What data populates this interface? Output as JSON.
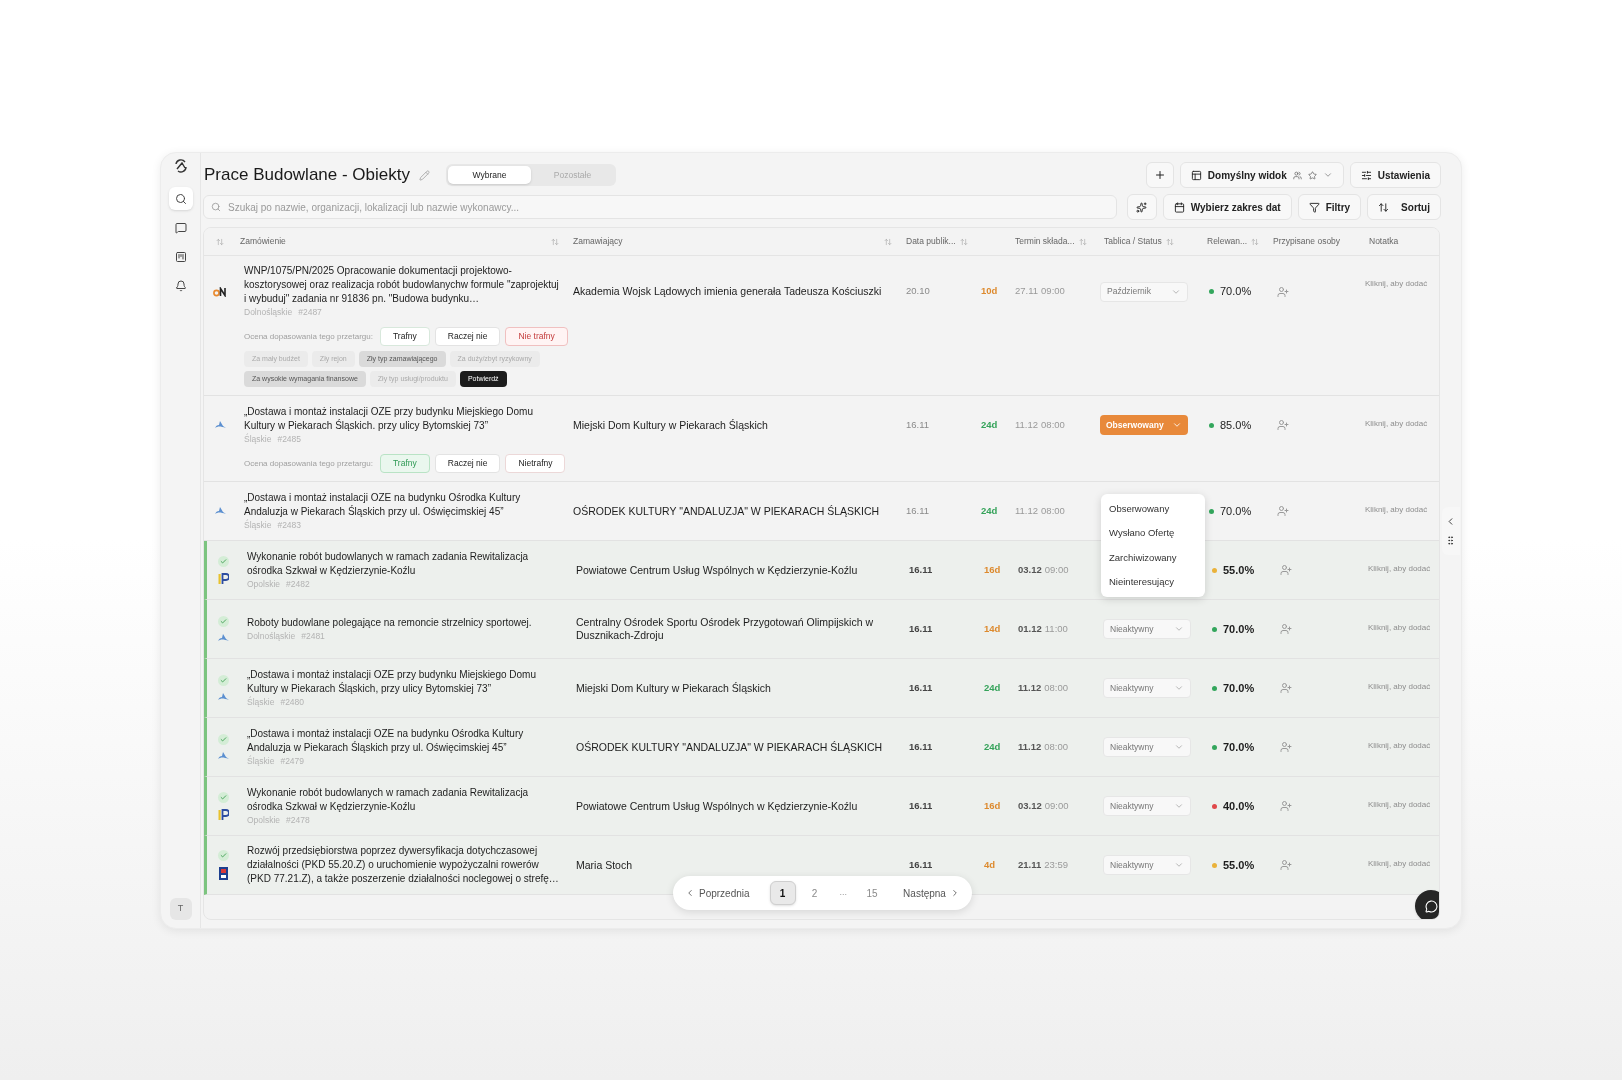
{
  "sidebar": {
    "items": [
      {
        "kind": "search",
        "selected": true
      },
      {
        "kind": "chat",
        "selected": false
      },
      {
        "kind": "board",
        "selected": false
      },
      {
        "kind": "alerts",
        "selected": false
      }
    ],
    "avatar": "T"
  },
  "title": "Prace Budowlane - Obiekty",
  "view_tabs": [
    {
      "label": "Wybrane",
      "selected": true
    },
    {
      "label": "Pozostałe",
      "selected": false
    }
  ],
  "toolbar": {
    "view_button": "Domyślny widok",
    "settings_button": "Ustawienia",
    "date_button": "Wybierz zakres dat",
    "filter_button": "Filtry",
    "sort_button": "Sortuj"
  },
  "search": {
    "placeholder": "Szukaj po nazwie, organizacji, lokalizacji lub nazwie wykonawcy..."
  },
  "table": {
    "columns": [
      {
        "sortable": true
      },
      {
        "label": "Zamówienie",
        "sortable": true
      },
      {
        "label": "Zamawiający",
        "sortable": true
      },
      {
        "label": "Data publik...",
        "sortable": true
      },
      {
        "sortable": false
      },
      {
        "label": "Termin składa...",
        "sortable": true
      },
      {
        "label": "Tablica / Status",
        "sortable": true
      },
      {
        "label": "Relewan...",
        "sortable": true
      },
      {
        "label": "Przypisane osoby",
        "sortable": false
      },
      {
        "label": "Notatka",
        "sortable": false
      }
    ],
    "rows": [
      {
        "logo": {
          "kind": "on"
        },
        "verified": false,
        "title": "WNP/1075/PN/2025 Opracowanie dokumentacji projektowo-kosztorysowej oraz realizacja robót budowlanychw formule \"zaprojektuj i wybuduj\" zadania nr 91836 pn. \"Budowa budynku…",
        "region": "Dolnośląskie",
        "number": "#2487",
        "client": "Akademia Wojsk Lądowych imienia generała Tadeusza Kościuszki",
        "published": "20.10",
        "days": {
          "text": "10d",
          "color": "#dd8a2e"
        },
        "deadline_date": "27.11",
        "deadline_time": "09:00",
        "status": {
          "label": "Październik"
        },
        "relevance": {
          "text": "70.0%",
          "color": "#33a65c"
        },
        "note": "Kliknij, aby dodać",
        "rating": {
          "label": "Ocena dopasowania tego przetargu:",
          "options": [
            {
              "label": "Trafny",
              "kind": "good",
              "selected": false
            },
            {
              "label": "Raczej nie",
              "kind": "neutral",
              "selected": false
            },
            {
              "label": "Nie trafny",
              "kind": "bad",
              "selected": true
            }
          ],
          "reasons": [
            {
              "label": "Za mały budżet",
              "selected": false
            },
            {
              "label": "Zły rejon",
              "selected": false
            },
            {
              "label": "Zły typ zamawiającego",
              "selected": true
            },
            {
              "label": "Za duży/zbyt ryzykowny",
              "selected": false
            },
            {
              "label": "Za wysokie wymagania finansowe",
              "selected": true
            },
            {
              "label": "Zły typ usługi/produktu",
              "selected": false
            }
          ],
          "confirm": "Potwierdź"
        }
      },
      {
        "logo": {
          "kind": "bird"
        },
        "verified": false,
        "title": "„Dostawa i montaż instalacji OZE przy budynku Miejskiego Domu Kultury w Piekarach Śląskich. przy ulicy Bytomskiej 73”",
        "region": "Śląskie",
        "number": "#2485",
        "client": "Miejski Dom Kultury w Piekarach Śląskich",
        "published": "16.11",
        "days": {
          "text": "24d",
          "color": "#35a35a"
        },
        "deadline_date": "11.12",
        "deadline_time": "08:00",
        "status": {
          "label": "Obserwowany",
          "color": "#e8893a"
        },
        "relevance": {
          "text": "85.0%",
          "color": "#33a65c"
        },
        "note": "Kliknij, aby dodać",
        "rating": {
          "label": "Ocena dopasowania tego przetargu:",
          "options": [
            {
              "label": "Trafny",
              "kind": "good",
              "selected": true
            },
            {
              "label": "Raczej nie",
              "kind": "neutral",
              "selected": false
            },
            {
              "label": "Nietrafny",
              "kind": "bad",
              "selected": false
            }
          ]
        }
      },
      {
        "logo": {
          "kind": "bird"
        },
        "verified": false,
        "title": "„Dostawa i montaż instalacji OZE na budynku Ośrodka Kultury Andaluzja w Piekarach Śląskich przy ul. Oświęcimskiej 45”",
        "region": "Śląskie",
        "number": "#2483",
        "client": "OŚRODEK KULTURY \"ANDALUZJA\" W PIEKARACH ŚLĄSKICH",
        "published": "16.11",
        "days": {
          "text": "24d",
          "color": "#35a35a"
        },
        "deadline_date": "11.12",
        "deadline_time": "08:00",
        "relevance": {
          "text": "70.0%",
          "color": "#33a65c"
        },
        "note": "Kliknij, aby dodać"
      },
      {
        "logo": {
          "kind": "ip"
        },
        "verified": true,
        "title": "Wykonanie robót budowlanych w ramach zadania Rewitalizacja ośrodka Szkwał w Kędzierzynie-Koźlu",
        "region": "Opolskie",
        "number": "#2482",
        "client": "Powiatowe Centrum Usług Wspólnych w Kędzierzynie-Koźlu",
        "published": "16.11",
        "days": {
          "text": "16d",
          "color": "#dd8a2e"
        },
        "deadline_date": "03.12",
        "deadline_time": "09:00",
        "relevance": {
          "text": "55.0%",
          "color": "#eab23a"
        },
        "note": "Kliknij, aby dodać"
      },
      {
        "logo": {
          "kind": "bird"
        },
        "verified": true,
        "title": "Roboty budowlane polegające na remoncie strzelnicy sportowej.",
        "region": "Dolnośląskie",
        "number": "#2481",
        "client": "Centralny Ośrodek Sportu Ośrodek Przygotowań Olimpijskich w Dusznikach-Zdroju",
        "published": "16.11",
        "days": {
          "text": "14d",
          "color": "#dd8a2e"
        },
        "deadline_date": "01.12",
        "deadline_time": "11:00",
        "status": {
          "label": "Nieaktywny"
        },
        "relevance": {
          "text": "70.0%",
          "color": "#33a65c"
        },
        "note": "Kliknij, aby dodać"
      },
      {
        "logo": {
          "kind": "bird"
        },
        "verified": true,
        "title": "„Dostawa i montaż instalacji OZE przy budynku Miejskiego Domu Kultury w Piekarach Śląskich, przy ulicy Bytomskiej 73”",
        "region": "Śląskie",
        "number": "#2480",
        "client": "Miejski Dom Kultury w Piekarach Śląskich",
        "published": "16.11",
        "days": {
          "text": "24d",
          "color": "#35a35a"
        },
        "deadline_date": "11.12",
        "deadline_time": "08:00",
        "status": {
          "label": "Nieaktywny"
        },
        "relevance": {
          "text": "70.0%",
          "color": "#33a65c"
        },
        "note": "Kliknij, aby dodać"
      },
      {
        "logo": {
          "kind": "bird"
        },
        "verified": true,
        "title": "„Dostawa i montaż instalacji OZE na budynku Ośrodka Kultury Andaluzja w Piekarach Śląskich przy ul. Oświęcimskiej 45”",
        "region": "Śląskie",
        "number": "#2479",
        "client": "OŚRODEK KULTURY \"ANDALUZJA\" W PIEKARACH ŚLĄSKICH",
        "published": "16.11",
        "days": {
          "text": "24d",
          "color": "#35a35a"
        },
        "deadline_date": "11.12",
        "deadline_time": "08:00",
        "status": {
          "label": "Nieaktywny"
        },
        "relevance": {
          "text": "70.0%",
          "color": "#33a65c"
        },
        "note": "Kliknij, aby dodać"
      },
      {
        "logo": {
          "kind": "ip"
        },
        "verified": true,
        "title": "Wykonanie robót budowlanych w ramach zadania Rewitalizacja ośrodka Szkwał w Kędzierzynie-Koźlu",
        "region": "Opolskie",
        "number": "#2478",
        "client": "Powiatowe Centrum Usług Wspólnych w Kędzierzynie-Koźlu",
        "published": "16.11",
        "days": {
          "text": "16d",
          "color": "#dd8a2e"
        },
        "deadline_date": "03.12",
        "deadline_time": "09:00",
        "status": {
          "label": "Nieaktywny"
        },
        "relevance": {
          "text": "40.0%",
          "color": "#e0484a"
        },
        "note": "Kliknij, aby dodać"
      },
      {
        "logo": {
          "kind": "flag"
        },
        "verified": true,
        "title": "Rozwój przedsiębiorstwa poprzez dywersyfikacja dotychczasowej działalności (PKD 55.20.Z) o uruchomienie wypożyczalni rowerów (PKD 77.21.Z), a także poszerzenie działalności noclegowej o strefę…",
        "client": "Maria Stoch",
        "published": "16.11",
        "days": {
          "text": "4d",
          "color": "#dd8a2e"
        },
        "deadline_date": "21.11",
        "deadline_time": "23:59",
        "status": {
          "label": "Nieaktywny"
        },
        "relevance": {
          "text": "55.0%",
          "color": "#eab23a"
        },
        "note": "Kliknij, aby dodać"
      }
    ]
  },
  "status_menu": {
    "items": [
      "Obserwowany",
      "Wysłano Ofertę",
      "Zarchiwizowany",
      "Nieinteresujący"
    ]
  },
  "pagination": {
    "previous": "Poprzednia",
    "next": "Następna",
    "pages": [
      {
        "label": "1",
        "kind": "page",
        "selected": true
      },
      {
        "label": "2",
        "kind": "page",
        "selected": false
      },
      {
        "label": "...",
        "kind": "gap"
      },
      {
        "label": "15",
        "kind": "page",
        "selected": false
      }
    ]
  }
}
